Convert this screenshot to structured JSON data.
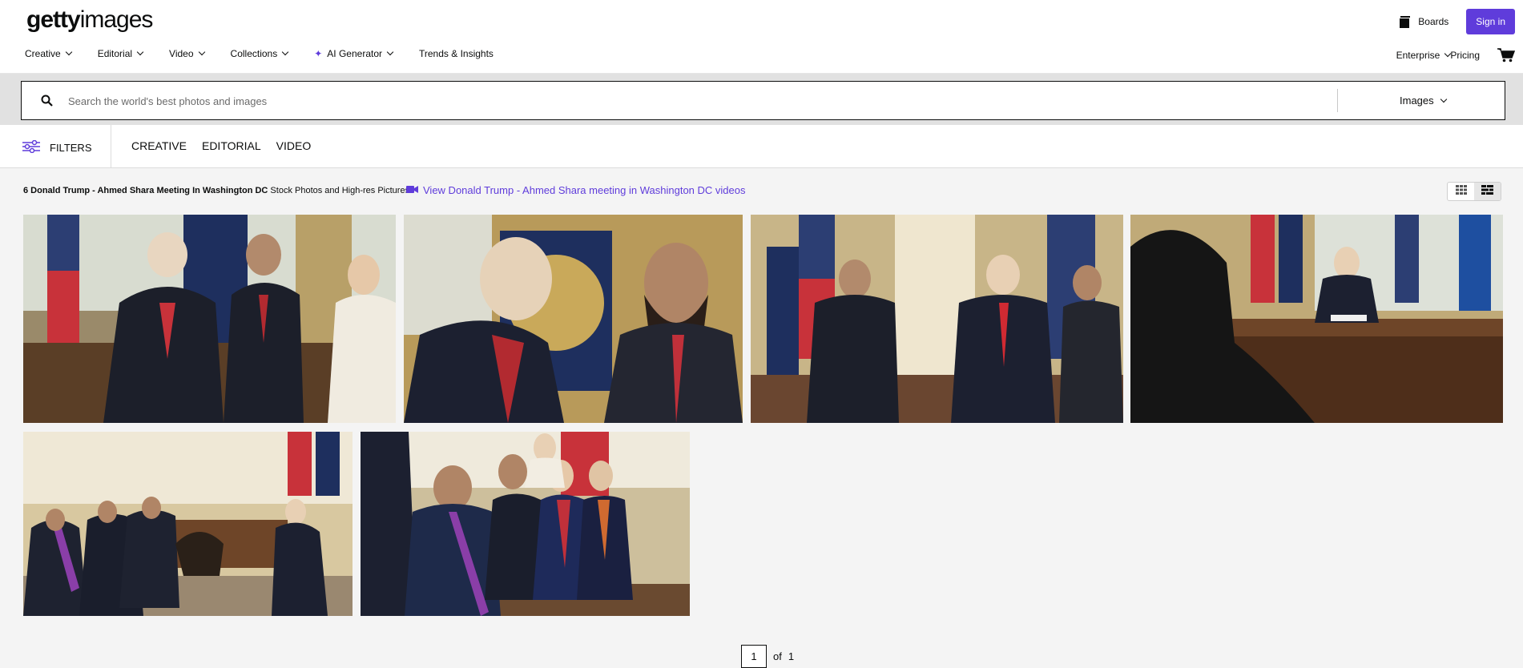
{
  "header": {
    "logo_bold": "getty",
    "logo_light": "images",
    "boards_label": "Boards",
    "signin_label": "Sign in"
  },
  "nav": {
    "items": [
      {
        "label": "Creative"
      },
      {
        "label": "Editorial"
      },
      {
        "label": "Video"
      },
      {
        "label": "Collections"
      },
      {
        "label": "AI Generator"
      },
      {
        "label": "Trends & Insights"
      }
    ],
    "enterprise_label": "Enterprise",
    "pricing_label": "Pricing"
  },
  "search": {
    "placeholder": "Search the world's best photos and images",
    "type_label": "Images"
  },
  "filters": {
    "label": "FILTERS",
    "tabs": [
      {
        "label": "CREATIVE"
      },
      {
        "label": "EDITORIAL"
      },
      {
        "label": "VIDEO"
      }
    ]
  },
  "results": {
    "title_bold": "6 Donald Trump - Ahmed Shara Meeting In Washington DC",
    "title_rest": " Stock Photos and High-res Pictures",
    "video_link": "View Donald Trump - Ahmed Shara meeting in Washington DC videos"
  },
  "pagination": {
    "current": "1",
    "of_label": "of",
    "total": "1"
  },
  "colors": {
    "accent": "#5f3cdb",
    "text": "#0c0d0d",
    "search_band": "#e1e1e1"
  }
}
